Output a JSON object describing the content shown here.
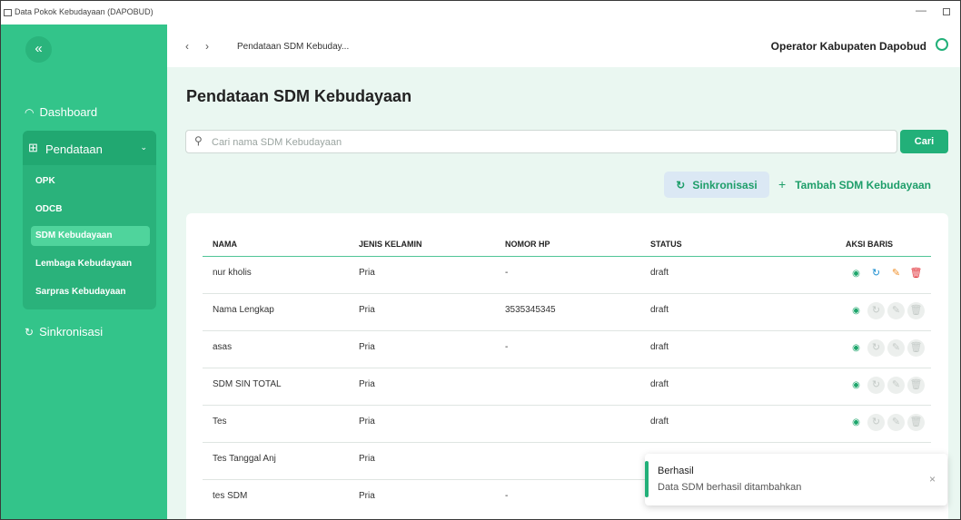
{
  "window": {
    "title": "Data Pokok Kebudayaan (DAPOBUD)",
    "minimize": "—"
  },
  "sidebar": {
    "collapse_icon": "«",
    "dashboard": "Dashboard",
    "pendataan": "Pendataan",
    "sub_items": [
      "OPK",
      "ODCB",
      "SDM Kebudayaan",
      "Lembaga Kebudayaan",
      "Sarpras Kebudayaan"
    ],
    "active_item": "SDM Kebudayaan",
    "sinkronisasi": "Sinkronisasi"
  },
  "topbar": {
    "breadcrumb": "Pendataan SDM Kebuday...",
    "user": "Operator Kabupaten Dapobud"
  },
  "page": {
    "title": "Pendataan SDM Kebudayaan",
    "search_placeholder": "Cari nama SDM Kebudayaan",
    "search_button": "Cari",
    "sync_button": "Sinkronisasi",
    "add_button": "Tambah SDM Kebudayaan"
  },
  "table": {
    "columns": [
      "NAMA",
      "JENIS KELAMIN",
      "NOMOR HP",
      "STATUS",
      "AKSI BARIS"
    ],
    "rows": [
      {
        "nama": "nur kholis",
        "jk": "Pria",
        "hp": "-",
        "status": "draft"
      },
      {
        "nama": "Nama Lengkap",
        "jk": "Pria",
        "hp": "3535345345",
        "status": "draft"
      },
      {
        "nama": "asas",
        "jk": "Pria",
        "hp": "-",
        "status": "draft"
      },
      {
        "nama": "SDM SIN TOTAL",
        "jk": "Pria",
        "hp": "",
        "status": "draft"
      },
      {
        "nama": "Tes",
        "jk": "Pria",
        "hp": "",
        "status": "draft"
      },
      {
        "nama": "Tes Tanggal Anj",
        "jk": "Pria",
        "hp": "",
        "status": ""
      },
      {
        "nama": "tes SDM",
        "jk": "Pria",
        "hp": "-",
        "status": ""
      }
    ]
  },
  "toast": {
    "title": "Berhasil",
    "message": "Data SDM berhasil ditambahkan",
    "close": "×"
  },
  "colors": {
    "primary": "#22b079",
    "sidebar": "#33c48a",
    "background": "#eaf7f1"
  }
}
